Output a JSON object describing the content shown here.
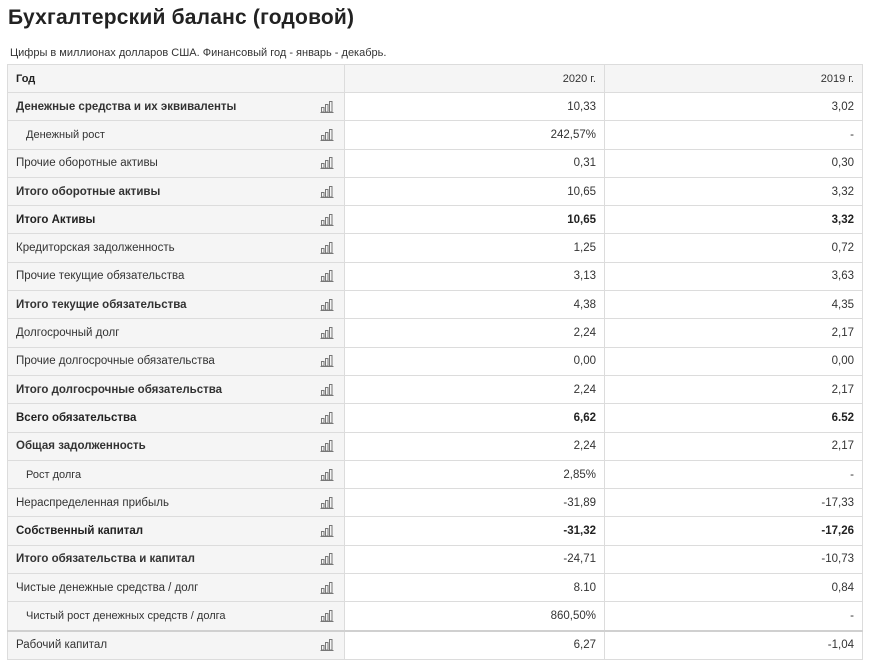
{
  "page": {
    "title": "Бухгалтерский баланс (годовой)",
    "subtitle": "Цифры в миллионах долларов США. Финансовый год - январь - декабрь."
  },
  "table": {
    "header": {
      "label": "Год",
      "col1": "2020 г.",
      "col2": "2019 г."
    },
    "rows": [
      {
        "label": "Денежные средства и их эквиваленты",
        "v2020": "10,33",
        "v2019": "3,02",
        "style": "semibold",
        "icon": "bar-chart-icon"
      },
      {
        "label": "Денежный рост",
        "v2020": "242,57%",
        "v2019": "-",
        "style": "indent",
        "icon": "bar-chart-icon"
      },
      {
        "label": "Прочие оборотные активы",
        "v2020": "0,31",
        "v2019": "0,30",
        "style": "normal",
        "icon": "bar-chart-icon"
      },
      {
        "label": "Итого оборотные активы",
        "v2020": "10,65",
        "v2019": "3,32",
        "style": "semibold",
        "icon": "bar-chart-icon"
      },
      {
        "label": "Итого Активы",
        "v2020": "10,65",
        "v2019": "3,32",
        "style": "bold",
        "icon": "bar-chart-icon"
      },
      {
        "label": "Кредиторская задолженность",
        "v2020": "1,25",
        "v2019": "0,72",
        "style": "normal",
        "icon": "bar-chart-icon"
      },
      {
        "label": "Прочие текущие обязательства",
        "v2020": "3,13",
        "v2019": "3,63",
        "style": "normal",
        "icon": "bar-chart-icon"
      },
      {
        "label": "Итого текущие обязательства",
        "v2020": "4,38",
        "v2019": "4,35",
        "style": "semibold",
        "icon": "bar-chart-icon"
      },
      {
        "label": "Долгосрочный долг",
        "v2020": "2,24",
        "v2019": "2,17",
        "style": "normal",
        "icon": "bar-chart-icon"
      },
      {
        "label": "Прочие долгосрочные обязательства",
        "v2020": "0,00",
        "v2019": "0,00",
        "style": "normal",
        "icon": "bar-chart-icon"
      },
      {
        "label": "Итого долгосрочные обязательства",
        "v2020": "2,24",
        "v2019": "2,17",
        "style": "semibold",
        "icon": "bar-chart-icon"
      },
      {
        "label": "Всего обязательства",
        "v2020": "6,62",
        "v2019": "6.52",
        "style": "bold",
        "icon": "bar-chart-icon"
      },
      {
        "label": "Общая задолженность",
        "v2020": "2,24",
        "v2019": "2,17",
        "style": "semibold",
        "icon": "bar-chart-icon"
      },
      {
        "label": "Рост долга",
        "v2020": "2,85%",
        "v2019": "-",
        "style": "indent",
        "icon": "bar-chart-icon"
      },
      {
        "label": "Нераспределенная прибыль",
        "v2020": "-31,89",
        "v2019": "-17,33",
        "style": "normal",
        "icon": "bar-chart-icon"
      },
      {
        "label": "Собственный капитал",
        "v2020": "-31,32",
        "v2019": "-17,26",
        "style": "bold",
        "icon": "bar-chart-icon"
      },
      {
        "label": "Итого обязательства и капитал",
        "v2020": "-24,71",
        "v2019": "-10,73",
        "style": "semibold",
        "icon": "bar-chart-icon"
      },
      {
        "label": "Чистые денежные средства / долг",
        "v2020": "8.10",
        "v2019": "0,84",
        "style": "normal",
        "icon": "bar-chart-icon"
      },
      {
        "label": "Чистый рост денежных средств / долга",
        "v2020": "860,50%",
        "v2019": "-",
        "style": "indent",
        "icon": "bar-chart-icon"
      },
      {
        "label": "Рабочий капитал",
        "v2020": "6,27",
        "v2019": "-1,04",
        "style": "sep",
        "icon": "bar-chart-icon"
      }
    ]
  }
}
